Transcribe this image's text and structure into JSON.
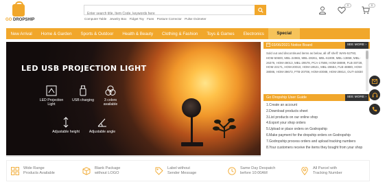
{
  "header": {
    "logo_text_go": "GO",
    "logo_text_rest": " DROPSHIP",
    "search_placeholder": "Enter search title, Item Code, keywords here",
    "hot_searches": [
      "Computer Table",
      "Jewelry Box",
      "Fidget Toy",
      "Fans",
      "Posture Corrector",
      "Pulse Oximeter"
    ],
    "wishlist_count": "0",
    "cart_count": "0"
  },
  "nav": {
    "items": [
      "New Arrival",
      "Home & Garden",
      "Sports & Outdoor",
      "Health & Beauty",
      "Clothing & Fashion",
      "Toys & Games",
      "Electronics",
      "Special"
    ]
  },
  "banner": {
    "title": "LED USB PROJECTION LIGHT",
    "features": [
      {
        "label": "LED Projection Light",
        "icon": "projector-icon"
      },
      {
        "label": "USB charging",
        "icon": "usb-icon"
      },
      {
        "label": "3 colors available",
        "icon": "color-circles-icon"
      },
      {
        "label": "Adjustable height",
        "icon": "height-arrows-icon"
      },
      {
        "label": "Adjustable angle",
        "icon": "angle-icon"
      }
    ]
  },
  "notice": {
    "date": "03/06/2021",
    "title": "Notice Board",
    "more": "SEE MORE",
    "text": "Sold out and discontinued items as below, all off shelf: WAN-52793, HOM-50600, MBL-24965, MBL-28261, MBL-61909, MBL-13858, MBL-26376, HOM-49013, MBL-29578, PCA-17598, HOM-38899, FLB-30728, HOM-23171, HOM-20010, HOM-19521, MBL-28684, FLB-48880, HOM-38086, HOM-39673, FTB-20708, HOM-40088, HOM-29814, OUT-44830"
  },
  "guide": {
    "title": "Go Dropship User Guide",
    "more": "SEE MORE",
    "steps": [
      "1.Create an account",
      "2.Download products sheet",
      "3.List products on our online shop",
      "4.Export your shop orders",
      "5.Upload or place orders on Godropship",
      "6.Make payment for the dropship orders on Godropship",
      "7.Godropship process orders and upload tracking numbers",
      "8.Your customers receive the items they bought from your shop"
    ]
  },
  "features": [
    {
      "line1": "Wide Range",
      "line2": "Products Available",
      "icon": "grid-icon"
    },
    {
      "line1": "Blank Package",
      "line2": "without LOGO",
      "icon": "box-icon"
    },
    {
      "line1": "Label without",
      "line2": "Sender Message",
      "icon": "label-tag-icon"
    },
    {
      "line1": "Same Day Despatch",
      "line2": "before 10:00AM",
      "icon": "clock-icon"
    },
    {
      "line1": "All Parcel with",
      "line2": "Tracking Number",
      "icon": "location-pin-icon"
    }
  ],
  "colors": {
    "accent": "#f1a72b",
    "special_tab": "#f6c35a",
    "dark": "#2d2d2d"
  }
}
